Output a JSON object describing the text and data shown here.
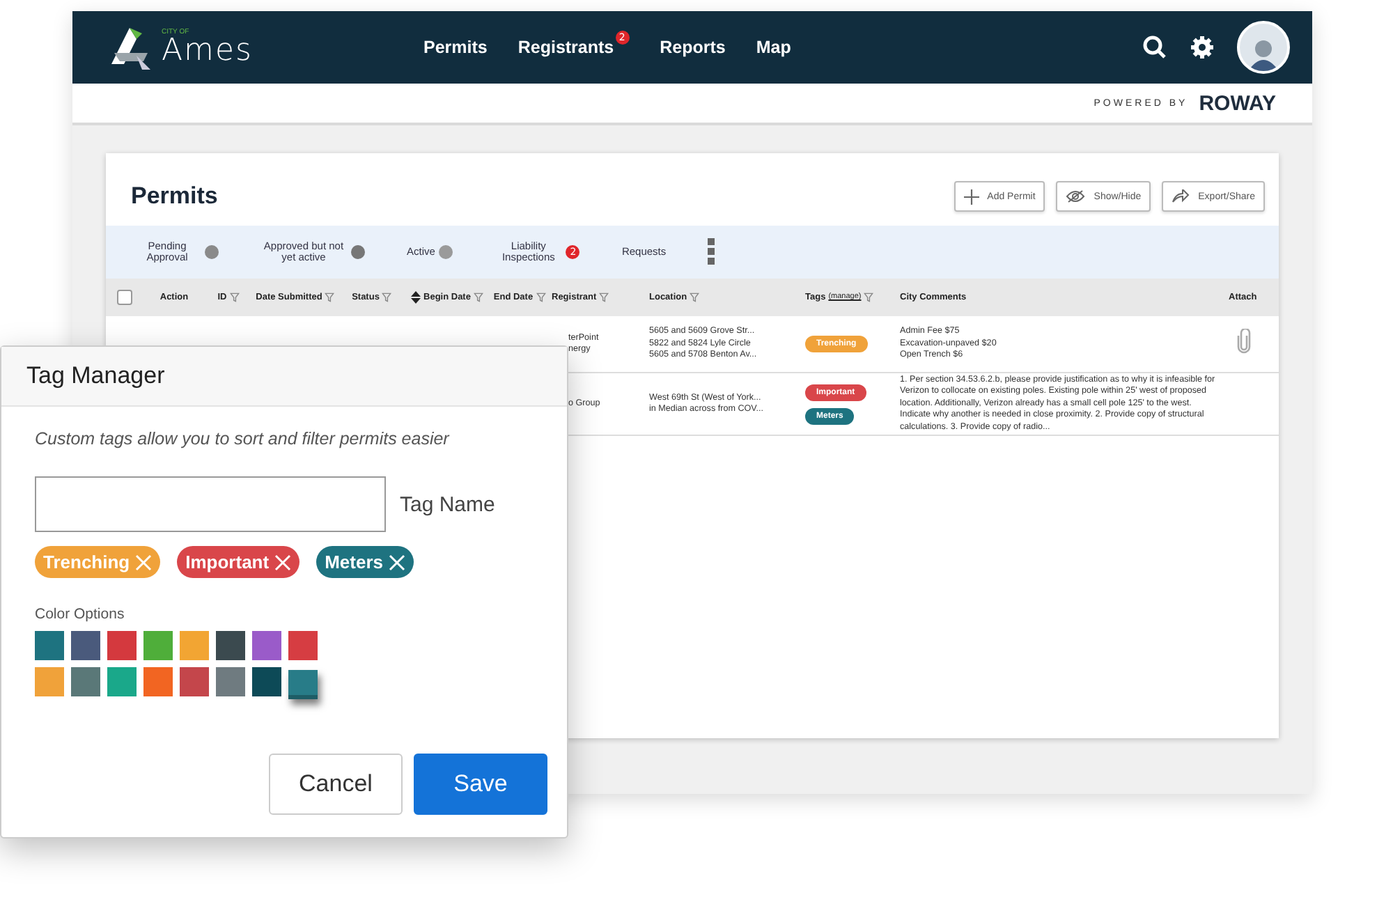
{
  "header": {
    "logo_small": "CITY OF",
    "logo": "Ames",
    "nav": [
      {
        "label": "Permits"
      },
      {
        "label": "Registrants",
        "badge": "2"
      },
      {
        "label": "Reports"
      },
      {
        "label": "Map"
      }
    ],
    "powered_by": "POWERED BY",
    "brand": "ROWAY"
  },
  "card": {
    "title": "Permits",
    "actions": [
      {
        "kind": "add",
        "label": "Add Permit"
      },
      {
        "kind": "eye",
        "label": "Show/Hide"
      },
      {
        "kind": "share",
        "label": "Export/Share"
      }
    ],
    "tabs": [
      {
        "label": "Pending Approval",
        "color": "#8a8a8a"
      },
      {
        "label": "Approved but not yet active",
        "color": "#777777"
      },
      {
        "label": "Active",
        "color": "#9a9a9a"
      },
      {
        "label": "Liability Inspections",
        "badge": "2",
        "color": "#e0262b"
      },
      {
        "label": "Requests"
      }
    ],
    "select_all": {
      "checked": false
    },
    "columns": [
      {
        "label": "Action",
        "filter": false
      },
      {
        "label": "ID",
        "filter": true
      },
      {
        "label": "Date Submitted",
        "filter": true
      },
      {
        "label": "Status",
        "filter": true
      },
      {
        "label": "Begin Date",
        "filter": true,
        "sort": true
      },
      {
        "label": "End Date",
        "filter": true
      },
      {
        "label": "Registrant",
        "filter": true
      },
      {
        "label": "Location",
        "filter": true
      },
      {
        "label": "Tags",
        "link": "(manage)",
        "filter": true
      },
      {
        "label": "City Comments",
        "filter": false
      },
      {
        "label": "Attach",
        "filter": false
      }
    ],
    "rows": [
      {
        "registrant": "terPoint\nnergy",
        "location": "5605 and 5609 Grove Str...\n5822 and 5824 Lyle Circle\n5605 and 5708 Benton Av...",
        "tags": [
          {
            "label": "Trenching",
            "color": "#f0a23a"
          }
        ],
        "comments": "Admin Fee $75\nExcavation-unpaved $20\nOpen Trench $6",
        "attachment": true
      },
      {
        "registrant": "o Group",
        "location": "West 69th St (West of York...\nin Median across from COV...",
        "tags": [
          {
            "label": "Important",
            "color": "#d9464a"
          },
          {
            "label": "Meters",
            "color": "#1e7380"
          }
        ],
        "comments": "1. Per section 34.53.6.2.b, please provide justification as to why it is infeasible for Verizon to collocate on existing poles. Existing pole within 25' west of proposed location. Additionally, Verizon already has a small cell pole 125' to the west. Indicate why another is needed in close proximity.  2. Provide copy of structural calculations. 3. Provide copy of radio...",
        "attachment": false
      }
    ]
  },
  "modal": {
    "title": "Tag Manager",
    "hint": "Custom tags allow you to sort and filter permits easier",
    "field_label": "Tag Name",
    "tags": [
      {
        "label": "Trenching",
        "color": "#f0a23a"
      },
      {
        "label": "Important",
        "color": "#d9464a"
      },
      {
        "label": "Meters",
        "color": "#1e7380"
      }
    ],
    "colors_label": "Color Options",
    "swatches": [
      {
        "color": "#1e7380",
        "selected": false
      },
      {
        "color": "#4a5a7c",
        "selected": false
      },
      {
        "color": "#d4393e",
        "selected": false
      },
      {
        "color": "#4fae3a",
        "selected": false
      },
      {
        "color": "#f2a533",
        "selected": false
      },
      {
        "color": "#3b4a4f",
        "selected": false
      },
      {
        "color": "#9a5bc9",
        "selected": false
      },
      {
        "color": "#d63d42",
        "selected": false
      },
      {
        "color": "#f0a23a",
        "selected": false
      },
      {
        "color": "#5a7878",
        "selected": false
      },
      {
        "color": "#1aa88a",
        "selected": false
      },
      {
        "color": "#f26522",
        "selected": false
      },
      {
        "color": "#c4464b",
        "selected": false
      },
      {
        "color": "#6f7b80",
        "selected": false
      },
      {
        "color": "#0d4a57",
        "selected": false
      },
      {
        "color": "#287c88",
        "selected": true
      }
    ],
    "buttons": [
      {
        "kind": "cancel",
        "label": "Cancel"
      },
      {
        "kind": "primary",
        "label": "Save"
      }
    ]
  }
}
